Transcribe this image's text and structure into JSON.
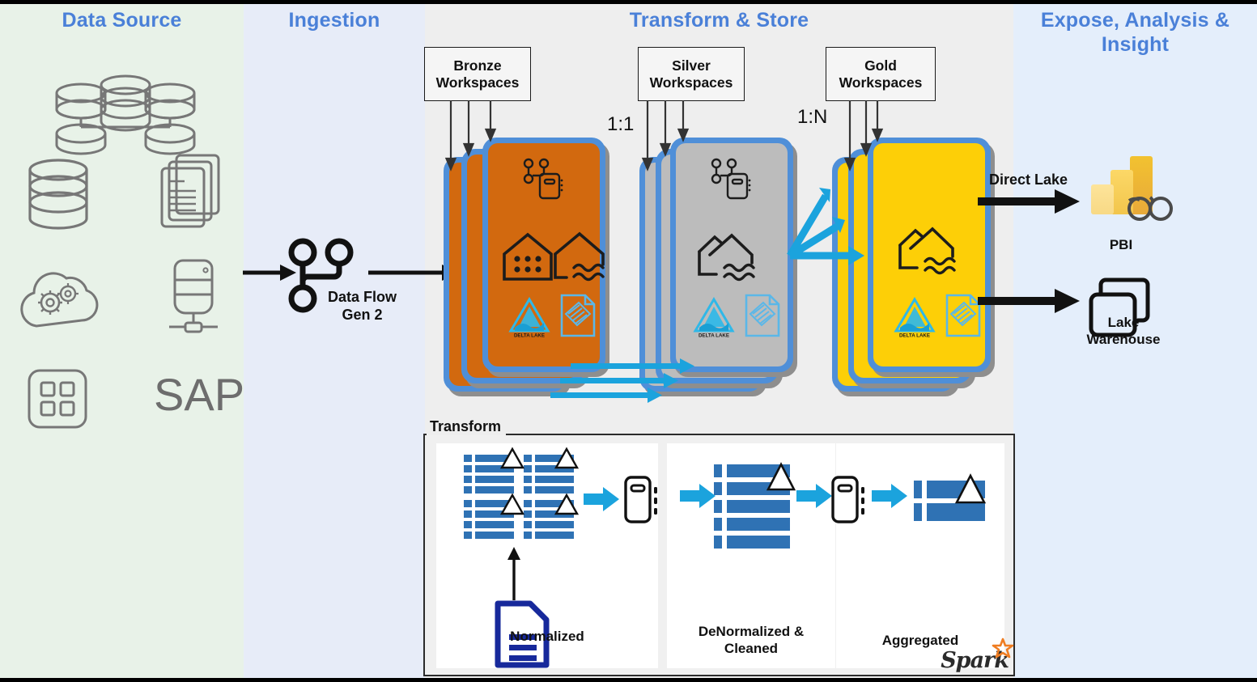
{
  "columns": [
    {
      "key": "source",
      "title": "Data Source",
      "bg": "#e8f2e8"
    },
    {
      "key": "ingest",
      "title": "Ingestion",
      "bg": "#e7ecf8"
    },
    {
      "key": "transform",
      "title": "Transform & Store",
      "bg": "#eeeeee"
    },
    {
      "key": "expose",
      "title": "Expose, Analysis & Insight",
      "bg": "#e4eefb"
    }
  ],
  "title_color": "#4a80d8",
  "data_source": {
    "icons": [
      {
        "name": "database-cluster-icon",
        "label": ""
      },
      {
        "name": "database-cylinder-icon",
        "label": ""
      },
      {
        "name": "documents-stack-icon",
        "label": ""
      },
      {
        "name": "cloud-gears-icon",
        "label": ""
      },
      {
        "name": "server-network-icon",
        "label": ""
      },
      {
        "name": "app-grid-icon",
        "label": ""
      }
    ],
    "sap_label": "SAP"
  },
  "ingestion": {
    "icon": "data-flow-icon",
    "label_line1": "Data Flow",
    "label_line2": "Gen 2"
  },
  "workspaces": [
    {
      "key": "bronze",
      "label_line1": "Bronze",
      "label_line2": "Workspaces",
      "color": "#d2690f",
      "icons": [
        "pipeline-notebook-icon",
        "warehouse-icon",
        "lakehouse-icon",
        "delta-lake-icon",
        "parquet-file-icon"
      ],
      "delta_lake_text": "DELTA LAKE"
    },
    {
      "key": "silver",
      "label_line1": "Silver",
      "label_line2": "Workspaces",
      "color": "#bcbcbc",
      "icons": [
        "pipeline-notebook-icon",
        "lakehouse-icon",
        "delta-lake-icon",
        "parquet-file-icon"
      ],
      "delta_lake_text": "DELTA LAKE"
    },
    {
      "key": "gold",
      "label_line1": "Gold",
      "label_line2": "Workspaces",
      "color": "#fdcf07",
      "icons": [
        "lakehouse-icon",
        "delta-lake-icon",
        "parquet-file-icon"
      ],
      "delta_lake_text": "DELTA LAKE"
    }
  ],
  "ratios": [
    {
      "key": "bronze-to-silver",
      "text": "1:1"
    },
    {
      "key": "silver-to-gold",
      "text": "1:N"
    }
  ],
  "outputs": {
    "direct_lake_label": "Direct Lake",
    "pbi": {
      "icon": "power-bi-icon",
      "label": "PBI"
    },
    "lake_warehouse": {
      "icon": "lake-warehouse-icon",
      "label_line1": "Lake",
      "label_line2": "Warehouse"
    }
  },
  "transform": {
    "legend": "Transform",
    "panels": [
      {
        "key": "normalized",
        "label": "Normalized",
        "label2": ""
      },
      {
        "key": "denormalized",
        "label": "DeNormalized &",
        "label2": "Cleaned"
      },
      {
        "key": "aggregated",
        "label": "Aggregated",
        "label2": ""
      }
    ],
    "source_doc_icon": "document-icon",
    "engine_icon": "compute-engine-icon",
    "table_icon": "table-icon",
    "spark_logo": "Spark",
    "arrow_color": "#1ba3dd"
  },
  "accent_colors": {
    "card_border_blue": "#4f8fd8",
    "arrow_blue": "#1ba3dd",
    "delta_lake_blue": "#2fb8e8",
    "parquet_blue": "#5ab7e8",
    "spark_orange": "#ef7d22",
    "table_blue": "#2f72b4",
    "doc_navy": "#17299b",
    "black": "#111111"
  }
}
